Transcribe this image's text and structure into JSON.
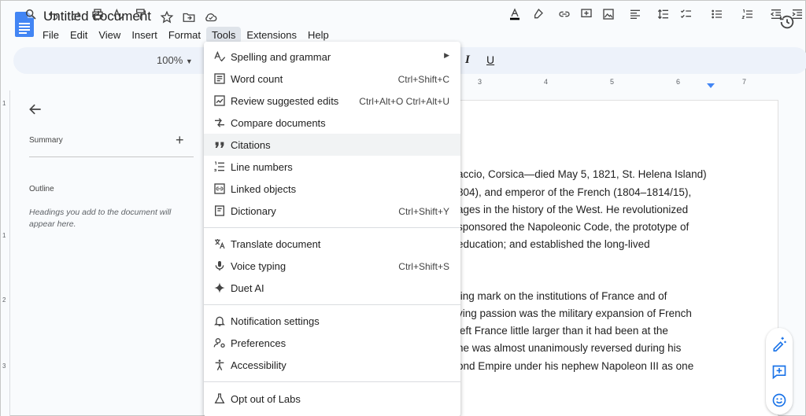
{
  "header": {
    "title": "Untitled document",
    "menu": [
      "File",
      "Edit",
      "View",
      "Insert",
      "Format",
      "Tools",
      "Extensions",
      "Help"
    ],
    "active_menu": "Tools"
  },
  "toolbar": {
    "zoom": "100%"
  },
  "panel": {
    "summary_label": "Summary",
    "summary_add": "+",
    "outline_label": "Outline",
    "outline_hint": "Headings you add to the document will appear here."
  },
  "ruler": {
    "h": [
      "3",
      "4",
      "5",
      "6",
      "7"
    ],
    "v": [
      "1",
      "1",
      "2",
      "3"
    ]
  },
  "tools_menu": {
    "items": [
      {
        "label": "Spelling and grammar",
        "shortcut": "",
        "submenu": true,
        "icon": "spellcheck-icon"
      },
      {
        "label": "Word count",
        "shortcut": "Ctrl+Shift+C",
        "icon": "word-count-icon"
      },
      {
        "label": "Review suggested edits",
        "shortcut": "Ctrl+Alt+O Ctrl+Alt+U",
        "icon": "review-edits-icon"
      },
      {
        "label": "Compare documents",
        "shortcut": "",
        "icon": "compare-icon"
      },
      {
        "label": "Citations",
        "shortcut": "",
        "icon": "quote-icon"
      },
      {
        "label": "Line numbers",
        "shortcut": "",
        "icon": "line-numbers-icon"
      },
      {
        "label": "Linked objects",
        "shortcut": "",
        "icon": "linked-objects-icon"
      },
      {
        "label": "Dictionary",
        "shortcut": "Ctrl+Shift+Y",
        "icon": "dictionary-icon"
      },
      {
        "label": "Translate document",
        "shortcut": "",
        "icon": "translate-icon"
      },
      {
        "label": "Voice typing",
        "shortcut": "Ctrl+Shift+S",
        "icon": "microphone-icon"
      },
      {
        "label": "Duet AI",
        "shortcut": "",
        "icon": "sparkle-icon"
      },
      {
        "label": "Notification settings",
        "shortcut": "",
        "icon": "bell-icon"
      },
      {
        "label": "Preferences",
        "shortcut": "",
        "icon": "preferences-icon"
      },
      {
        "label": "Accessibility",
        "shortcut": "",
        "icon": "accessibility-icon"
      },
      {
        "label": "Opt out of Labs",
        "shortcut": "",
        "icon": "flask-icon"
      }
    ]
  },
  "document": {
    "lines": [
      "accio, Corsica—died May 5, 1821, St. Helena Island)",
      "804), and emperor of the French (1804–1814/15),",
      "ages in the history of the West. He revolutionized",
      "sponsored the Napoleonic Code, the prototype of",
      "education; and established the long-lived",
      "ting mark on the institutions of France and of",
      "ving passion was the military expansion of French",
      "left France little larger than it had been at the",
      "he was almost unanimously reversed during his",
      "ond Empire under his nephew Napoleon III as one"
    ]
  },
  "colors": {
    "accent": "#1a73e8",
    "toolbar_bg": "#edf2fa",
    "menu_highlight": "#f1f3f4"
  }
}
